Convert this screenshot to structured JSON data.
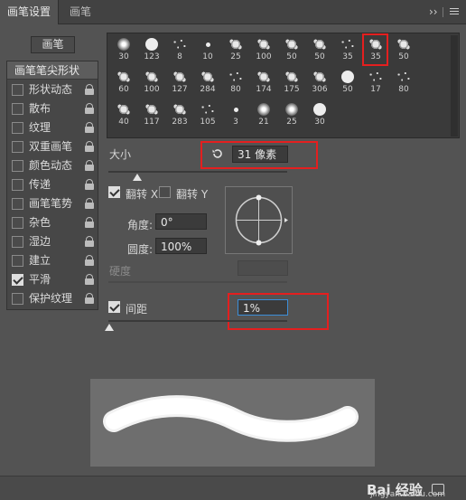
{
  "tabs": {
    "active": "画笔设置",
    "second": "画笔"
  },
  "toolbar": {
    "expand_icon": "double-chevron-right-icon",
    "menu_icon": "hamburger-menu-icon"
  },
  "brushes_button": "画笔",
  "sidebar": {
    "header": "画笔笔尖形状",
    "items": [
      {
        "label": "形状动态",
        "checked": false
      },
      {
        "label": "散布",
        "checked": false
      },
      {
        "label": "纹理",
        "checked": false
      },
      {
        "label": "双重画笔",
        "checked": false
      },
      {
        "label": "颜色动态",
        "checked": false
      },
      {
        "label": "传递",
        "checked": false
      },
      {
        "label": "画笔笔势",
        "checked": false
      },
      {
        "label": "杂色",
        "checked": false
      },
      {
        "label": "湿边",
        "checked": false
      },
      {
        "label": "建立",
        "checked": false
      },
      {
        "label": "平滑",
        "checked": true
      },
      {
        "label": "保护纹理",
        "checked": false
      }
    ]
  },
  "brush_tips": [
    {
      "size": "30",
      "kind": "soft",
      "selected": false
    },
    {
      "size": "123",
      "kind": "hard",
      "selected": false
    },
    {
      "size": "8",
      "kind": "specks",
      "selected": false
    },
    {
      "size": "10",
      "kind": "small",
      "selected": false
    },
    {
      "size": "25",
      "kind": "splat",
      "selected": false
    },
    {
      "size": "100",
      "kind": "splat",
      "selected": false
    },
    {
      "size": "50",
      "kind": "splat",
      "selected": false
    },
    {
      "size": "50",
      "kind": "splat",
      "selected": false
    },
    {
      "size": "35",
      "kind": "specks",
      "selected": false
    },
    {
      "size": "35",
      "kind": "splat",
      "selected": true
    },
    {
      "size": "50",
      "kind": "splat",
      "selected": false
    },
    {
      "size": "60",
      "kind": "splat",
      "selected": false
    },
    {
      "size": "100",
      "kind": "splat",
      "selected": false
    },
    {
      "size": "127",
      "kind": "splat",
      "selected": false
    },
    {
      "size": "284",
      "kind": "splat",
      "selected": false
    },
    {
      "size": "80",
      "kind": "specks",
      "selected": false
    },
    {
      "size": "174",
      "kind": "splat",
      "selected": false
    },
    {
      "size": "175",
      "kind": "splat",
      "selected": false
    },
    {
      "size": "306",
      "kind": "splat",
      "selected": false
    },
    {
      "size": "50",
      "kind": "hard",
      "selected": false
    },
    {
      "size": "17",
      "kind": "specks",
      "selected": false
    },
    {
      "size": "80",
      "kind": "specks",
      "selected": false
    },
    {
      "size": "40",
      "kind": "splat",
      "selected": false
    },
    {
      "size": "117",
      "kind": "splat",
      "selected": false
    },
    {
      "size": "283",
      "kind": "splat",
      "selected": false
    },
    {
      "size": "105",
      "kind": "specks",
      "selected": false
    },
    {
      "size": "3",
      "kind": "small",
      "selected": false
    },
    {
      "size": "21",
      "kind": "soft",
      "selected": false
    },
    {
      "size": "25",
      "kind": "soft",
      "selected": false
    },
    {
      "size": "30",
      "kind": "hard",
      "selected": false
    }
  ],
  "size": {
    "label": "大小",
    "value": "31 像素",
    "reset_icon": "reset-icon",
    "slider_fraction": 0.16
  },
  "flip": {
    "x_label": "翻转 X",
    "x_checked": true,
    "y_label": "翻转 Y",
    "y_checked": false
  },
  "angle": {
    "label": "角度:",
    "value": "0°"
  },
  "roundness": {
    "label": "圆度:",
    "value": "100%"
  },
  "hardness": {
    "label": "硬度",
    "value": ""
  },
  "spacing": {
    "label": "间距",
    "checked": true,
    "value": "1%",
    "slider_fraction": 0.0
  },
  "watermark": {
    "brand": "Bai 经验",
    "url": "jingyan.baidu.com"
  },
  "bottom_icons": [
    "new-brush-icon"
  ]
}
